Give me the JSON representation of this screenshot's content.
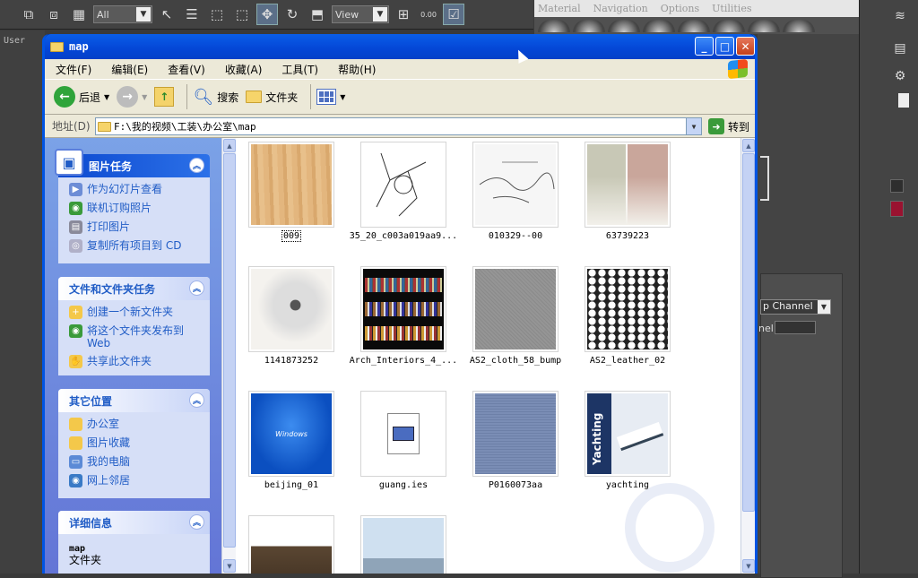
{
  "max": {
    "selection_filter": "All",
    "ref_coord": "View",
    "viewport_label": "User",
    "snap_value": "0.00",
    "mat_menu": [
      "Material",
      "Navigation",
      "Options",
      "Utilities"
    ],
    "channel_dropdown": "p Channel",
    "channel_label": "nel:"
  },
  "window": {
    "title": "map",
    "menus": [
      "文件(F)",
      "编辑(E)",
      "查看(V)",
      "收藏(A)",
      "工具(T)",
      "帮助(H)"
    ],
    "back_label": "后退",
    "search_label": "搜索",
    "folders_label": "文件夹",
    "address_label": "地址(D)",
    "address_value": "F:\\我的视频\\工装\\办公室\\map",
    "goto_label": "转到"
  },
  "left_pane": {
    "picture_tasks": {
      "title": "图片任务",
      "items": [
        "作为幻灯片查看",
        "联机订购照片",
        "打印图片",
        "复制所有项目到 CD"
      ]
    },
    "file_tasks": {
      "title": "文件和文件夹任务",
      "items": [
        "创建一个新文件夹",
        "将这个文件夹发布到 Web",
        "共享此文件夹"
      ]
    },
    "other_places": {
      "title": "其它位置",
      "items": [
        "办公室",
        "图片收藏",
        "我的电脑",
        "网上邻居"
      ]
    },
    "details": {
      "title": "详细信息",
      "name": "map",
      "type": "文件夹"
    }
  },
  "files": [
    {
      "name": "009"
    },
    {
      "name": "35_20_c003a019aa9..."
    },
    {
      "name": "010329--00"
    },
    {
      "name": "63739223"
    },
    {
      "name": "1141873252"
    },
    {
      "name": "Arch_Interiors_4_..."
    },
    {
      "name": "AS2_cloth_58_bump"
    },
    {
      "name": "AS2_leather_02"
    },
    {
      "name": "beijing_01"
    },
    {
      "name": "guang.ies"
    },
    {
      "name": "P0160073aa"
    },
    {
      "name": "yachting"
    },
    {
      "name": ""
    },
    {
      "name": ""
    }
  ],
  "thumb_texts": {
    "windows": "Windows",
    "yachting": "Yachting"
  }
}
